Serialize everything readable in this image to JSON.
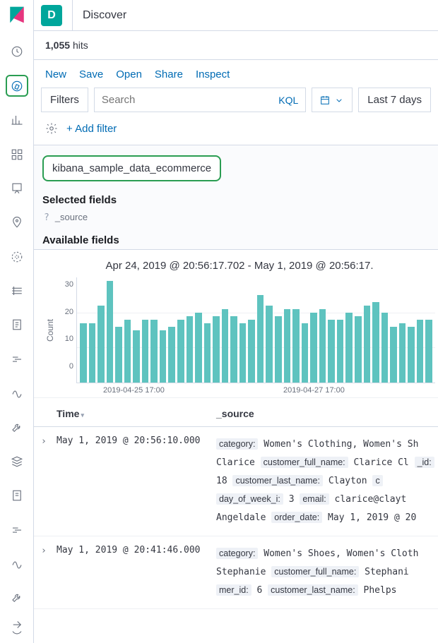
{
  "space_initial": "D",
  "app_title": "Discover",
  "hits_count": "1,055",
  "hits_label": "hits",
  "actions": {
    "new": "New",
    "save": "Save",
    "open": "Open",
    "share": "Share",
    "inspect": "Inspect"
  },
  "filters_label": "Filters",
  "search_placeholder": "Search",
  "kql_label": "KQL",
  "daterange_display": "Last 7 days",
  "add_filter_label": "+ Add filter",
  "index_pattern": "kibana_sample_data_ecommerce",
  "selected_fields_heading": "Selected fields",
  "source_field_label": "_source",
  "available_fields_heading": "Available fields",
  "histogram_range": "Apr 24, 2019 @ 20:56:17.702 - May 1, 2019 @ 20:56:17.",
  "table_headers": {
    "time": "Time",
    "source": "_source"
  },
  "chart_data": {
    "type": "bar",
    "ylabel": "Count",
    "ylim": [
      0,
      30
    ],
    "yticks": [
      0,
      10,
      20,
      30
    ],
    "xticks": [
      "2019-04-25 17:00",
      "2019-04-27 17:00"
    ],
    "values": [
      17,
      17,
      22,
      29,
      16,
      18,
      15,
      18,
      18,
      15,
      16,
      18,
      19,
      20,
      17,
      19,
      21,
      19,
      17,
      18,
      25,
      22,
      19,
      21,
      21,
      17,
      20,
      21,
      18,
      18,
      20,
      19,
      22,
      23,
      20,
      16,
      17,
      16,
      18,
      18
    ]
  },
  "rows": [
    {
      "time": "May 1, 2019 @ 20:56:10.000",
      "src_html": "<span class='k'>category:</span> Women's Clothing, Women's Sh Clarice <span class='k'>customer_full_name:</span> Clarice Cl <span class='k'>_id:</span> 18 <span class='k'>customer_last_name:</span> Clayton <span class='k'>c</span> <span class='k'>day_of_week_i:</span> 3 <span class='k'>email:</span> clarice@clayt Angeldale <span class='k'>order_date:</span> May 1, 2019 @ 20"
    },
    {
      "time": "May 1, 2019 @ 20:41:46.000",
      "src_html": "<span class='k'>category:</span> Women's Shoes, Women's Cloth Stephanie <span class='k'>customer_full_name:</span> Stephani <span class='k'>mer_id:</span> 6 <span class='k'>customer_last_name:</span> Phelps"
    }
  ]
}
